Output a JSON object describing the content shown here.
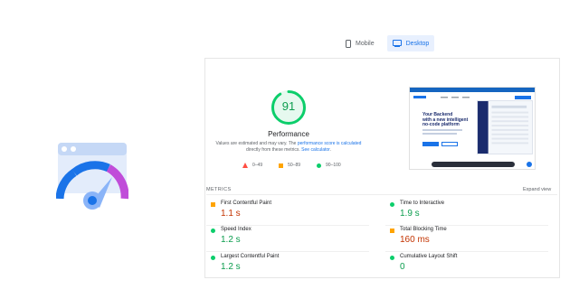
{
  "tabs": [
    {
      "label": "Mobile",
      "icon": "phone-icon",
      "active": false
    },
    {
      "label": "Desktop",
      "icon": "monitor-icon",
      "active": true
    }
  ],
  "performance": {
    "score": "91",
    "score_value": 91,
    "title": "Performance",
    "note_prefix": "Values are estimated and may vary. The ",
    "note_link": "performance score is calculated",
    "note_middle": " directly from these metrics. ",
    "note_link2": "See calculator",
    "note_suffix": ".",
    "legend": [
      {
        "label": "0–49",
        "icon": "red-triangle-icon"
      },
      {
        "label": "50–89",
        "icon": "orange-square-icon"
      },
      {
        "label": "90–100",
        "icon": "green-circle-icon"
      }
    ],
    "colors": {
      "good": "#0cce6b",
      "average": "#ffa400",
      "poor": "#ff4e42"
    }
  },
  "screenshot": {
    "headline_1": "Your Backend",
    "headline_2": "with a new intelligent",
    "headline_3": "no-code platform"
  },
  "metrics": {
    "section_label": "METRICS",
    "expand_label": "Expand view",
    "items": [
      {
        "label": "First Contentful Paint",
        "value": "1.1 s",
        "status": "average"
      },
      {
        "label": "Time to Interactive",
        "value": "1.9 s",
        "status": "good"
      },
      {
        "label": "Speed Index",
        "value": "1.2 s",
        "status": "good"
      },
      {
        "label": "Total Blocking Time",
        "value": "160 ms",
        "status": "average"
      },
      {
        "label": "Largest Contentful Paint",
        "value": "1.2 s",
        "status": "good"
      },
      {
        "label": "Cumulative Layout Shift",
        "value": "0",
        "status": "good"
      }
    ]
  }
}
